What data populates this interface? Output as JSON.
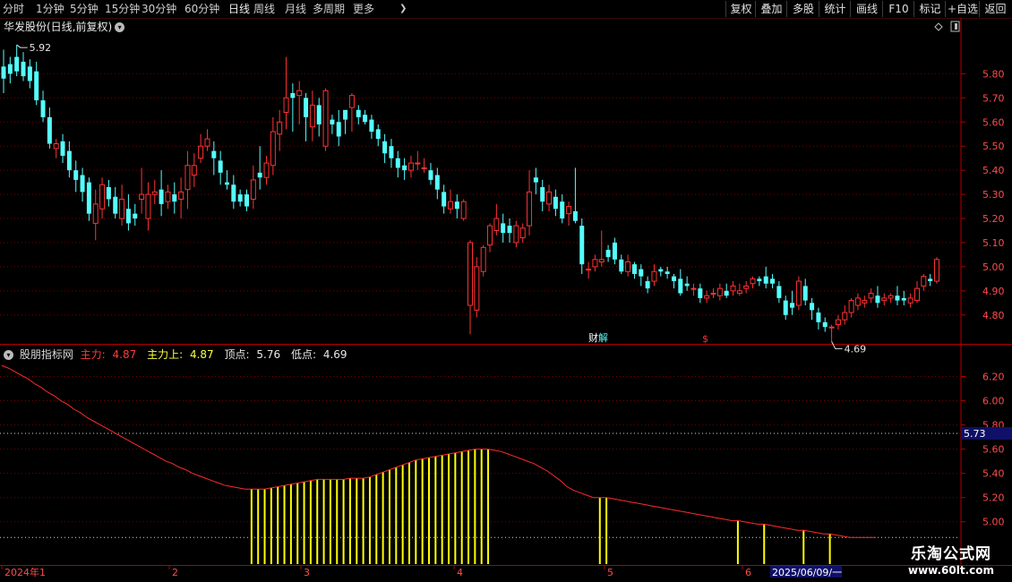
{
  "toolbar": {
    "periods": [
      "分时",
      "1分钟",
      "5分钟",
      "15分钟",
      "30分钟",
      "60分钟",
      "日线",
      "周线",
      "月线",
      "多周期",
      "更多"
    ],
    "more_arrow": "❯",
    "right_buttons": [
      "复权",
      "叠加",
      "多股",
      "统计",
      "画线",
      "F10",
      "标记",
      "+自选",
      "返回"
    ]
  },
  "main_title": {
    "text": "华发股份(日线,前复权)",
    "circle": "▾"
  },
  "indicator_title": {
    "name": "股朋指标网",
    "l1": "主力:",
    "v1": "4.87",
    "l2": "主力上:",
    "v2": "4.87",
    "l3": "顶点:",
    "v3": "5.76",
    "l4": "低点:",
    "v4": "4.69"
  },
  "watermark": {
    "name": "乐淘公式网",
    "url": "www.60lt.com"
  },
  "chart_data": [
    {
      "type": "candlestick",
      "title": "华发股份(日线,前复权)",
      "y_ticks": [
        5.8,
        5.7,
        5.6,
        5.5,
        5.4,
        5.3,
        5.2,
        5.1,
        5.0,
        4.9,
        4.8
      ],
      "ylim": [
        4.71,
        5.95
      ],
      "max_label": "5.92",
      "min_label": "4.69",
      "event_labels": [
        "财",
        "解",
        "$"
      ],
      "colors": {
        "up": "#ff3232",
        "down": "#54ffff",
        "grid": "#7a0000",
        "axis_text": "#ff4c4c"
      },
      "bars": [
        [
          5.83,
          5.78,
          5.9,
          5.72
        ],
        [
          5.84,
          5.8,
          5.87,
          5.76
        ],
        [
          5.87,
          5.81,
          5.92,
          5.79
        ],
        [
          5.85,
          5.79,
          5.89,
          5.77
        ],
        [
          5.83,
          5.77,
          5.86,
          5.74
        ],
        [
          5.81,
          5.69,
          5.85,
          5.67
        ],
        [
          5.69,
          5.62,
          5.73,
          5.6
        ],
        [
          5.62,
          5.51,
          5.66,
          5.49
        ],
        [
          5.49,
          5.51,
          5.53,
          5.45
        ],
        [
          5.52,
          5.46,
          5.55,
          5.43
        ],
        [
          5.48,
          5.4,
          5.52,
          5.37
        ],
        [
          5.4,
          5.36,
          5.44,
          5.31
        ],
        [
          5.38,
          5.31,
          5.41,
          5.27
        ],
        [
          5.35,
          5.22,
          5.37,
          5.19
        ],
        [
          5.18,
          5.26,
          5.32,
          5.11
        ],
        [
          5.24,
          5.34,
          5.37,
          5.2
        ],
        [
          5.33,
          5.28,
          5.36,
          5.25
        ],
        [
          5.29,
          5.22,
          5.33,
          5.2
        ],
        [
          5.2,
          5.28,
          5.34,
          5.17
        ],
        [
          5.24,
          5.18,
          5.3,
          5.15
        ],
        [
          5.22,
          5.2,
          5.26,
          5.17
        ],
        [
          5.28,
          5.3,
          5.41,
          5.22
        ],
        [
          5.2,
          5.3,
          5.35,
          5.15
        ],
        [
          5.3,
          5.31,
          5.36,
          5.26
        ],
        [
          5.32,
          5.26,
          5.4,
          5.21
        ],
        [
          5.27,
          5.31,
          5.34,
          5.24
        ],
        [
          5.3,
          5.27,
          5.35,
          5.22
        ],
        [
          5.28,
          5.31,
          5.37,
          5.2
        ],
        [
          5.32,
          5.42,
          5.48,
          5.24
        ],
        [
          5.38,
          5.42,
          5.47,
          5.33
        ],
        [
          5.45,
          5.5,
          5.55,
          5.43
        ],
        [
          5.5,
          5.53,
          5.57,
          5.48
        ],
        [
          5.48,
          5.45,
          5.52,
          5.38
        ],
        [
          5.44,
          5.39,
          5.48,
          5.34
        ],
        [
          5.35,
          5.34,
          5.4,
          5.32
        ],
        [
          5.34,
          5.27,
          5.38,
          5.24
        ],
        [
          5.3,
          5.27,
          5.32,
          5.25
        ],
        [
          5.3,
          5.25,
          5.32,
          5.23
        ],
        [
          5.28,
          5.36,
          5.42,
          5.24
        ],
        [
          5.39,
          5.37,
          5.5,
          5.32
        ],
        [
          5.37,
          5.43,
          5.46,
          5.34
        ],
        [
          5.42,
          5.56,
          5.62,
          5.38
        ],
        [
          5.55,
          5.6,
          5.65,
          5.48
        ],
        [
          5.64,
          5.7,
          5.87,
          5.57
        ],
        [
          5.72,
          5.7,
          5.76,
          5.56
        ],
        [
          5.71,
          5.73,
          5.77,
          5.59
        ],
        [
          5.7,
          5.62,
          5.72,
          5.52
        ],
        [
          5.58,
          5.67,
          5.73,
          5.52
        ],
        [
          5.67,
          5.59,
          5.7,
          5.54
        ],
        [
          5.5,
          5.73,
          5.74,
          5.48
        ],
        [
          5.61,
          5.59,
          5.63,
          5.55
        ],
        [
          5.6,
          5.54,
          5.65,
          5.5
        ],
        [
          5.65,
          5.61,
          5.64,
          5.55
        ],
        [
          5.66,
          5.71,
          5.72,
          5.56
        ],
        [
          5.65,
          5.62,
          5.67,
          5.59
        ],
        [
          5.63,
          5.6,
          5.65,
          5.59
        ],
        [
          5.61,
          5.56,
          5.63,
          5.53
        ],
        [
          5.57,
          5.53,
          5.59,
          5.5
        ],
        [
          5.52,
          5.47,
          5.55,
          5.43
        ],
        [
          5.5,
          5.45,
          5.53,
          5.41
        ],
        [
          5.45,
          5.41,
          5.48,
          5.37
        ],
        [
          5.42,
          5.4,
          5.45,
          5.36
        ],
        [
          5.4,
          5.43,
          5.46,
          5.37
        ],
        [
          5.43,
          5.43,
          5.48,
          5.4
        ],
        [
          5.41,
          5.41,
          5.45,
          5.39
        ],
        [
          5.4,
          5.36,
          5.43,
          5.34
        ],
        [
          5.38,
          5.32,
          5.41,
          5.28
        ],
        [
          5.31,
          5.25,
          5.34,
          5.22
        ],
        [
          5.24,
          5.27,
          5.32,
          5.22
        ],
        [
          5.27,
          5.24,
          5.3,
          5.2
        ],
        [
          5.2,
          5.27,
          5.28,
          5.19
        ],
        [
          4.84,
          5.1,
          5.11,
          4.72
        ],
        [
          4.82,
          5.0,
          5.04,
          4.79
        ],
        [
          4.98,
          5.08,
          5.09,
          4.96
        ],
        [
          5.09,
          5.17,
          5.18,
          5.06
        ],
        [
          5.15,
          5.2,
          5.26,
          5.13
        ],
        [
          5.18,
          5.14,
          5.22,
          5.1
        ],
        [
          5.17,
          5.14,
          5.2,
          5.1
        ],
        [
          5.1,
          5.17,
          5.19,
          5.08
        ],
        [
          5.12,
          5.16,
          5.18,
          5.1
        ],
        [
          5.17,
          5.31,
          5.4,
          5.13
        ],
        [
          5.37,
          5.35,
          5.41,
          5.3
        ],
        [
          5.33,
          5.27,
          5.36,
          5.23
        ],
        [
          5.26,
          5.31,
          5.34,
          5.23
        ],
        [
          5.29,
          5.24,
          5.32,
          5.21
        ],
        [
          5.27,
          5.2,
          5.3,
          5.18
        ],
        [
          5.22,
          5.25,
          5.27,
          5.17
        ],
        [
          5.23,
          5.19,
          5.41,
          5.18
        ],
        [
          5.17,
          5.01,
          5.2,
          4.97
        ],
        [
          4.99,
          4.99,
          5.02,
          4.95
        ],
        [
          5.0,
          5.03,
          5.05,
          4.98
        ],
        [
          5.02,
          5.03,
          5.15,
          5.0
        ],
        [
          5.07,
          5.04,
          5.09,
          5.02
        ],
        [
          5.1,
          5.03,
          5.12,
          5.01
        ],
        [
          5.03,
          4.98,
          5.05,
          4.97
        ],
        [
          4.98,
          5.02,
          5.05,
          4.96
        ],
        [
          5.01,
          4.97,
          5.02,
          4.95
        ],
        [
          4.99,
          4.96,
          5.01,
          4.92
        ],
        [
          4.94,
          4.91,
          4.96,
          4.89
        ],
        [
          4.94,
          4.98,
          5.01,
          4.92
        ],
        [
          4.99,
          4.98,
          5.0,
          4.96
        ],
        [
          4.98,
          4.97,
          5.0,
          4.95
        ],
        [
          4.96,
          4.94,
          4.97,
          4.91
        ],
        [
          4.95,
          4.89,
          4.99,
          4.88
        ],
        [
          4.93,
          4.92,
          4.96,
          4.9
        ],
        [
          4.91,
          4.91,
          4.93,
          4.88
        ],
        [
          4.91,
          4.87,
          4.93,
          4.85
        ],
        [
          4.87,
          4.88,
          4.9,
          4.85
        ],
        [
          4.89,
          4.89,
          4.91,
          4.87
        ],
        [
          4.88,
          4.91,
          4.93,
          4.86
        ],
        [
          4.9,
          4.88,
          4.93,
          4.87
        ],
        [
          4.9,
          4.92,
          4.94,
          4.88
        ],
        [
          4.89,
          4.9,
          4.93,
          4.88
        ],
        [
          4.91,
          4.92,
          4.94,
          4.89
        ],
        [
          4.93,
          4.95,
          4.96,
          4.91
        ],
        [
          4.95,
          4.94,
          4.96,
          4.92
        ],
        [
          4.96,
          4.93,
          5.0,
          4.91
        ],
        [
          4.95,
          4.93,
          4.97,
          4.91
        ],
        [
          4.92,
          4.87,
          4.94,
          4.85
        ],
        [
          4.86,
          4.8,
          4.88,
          4.78
        ],
        [
          4.85,
          4.83,
          4.9,
          4.8
        ],
        [
          4.84,
          4.94,
          4.96,
          4.82
        ],
        [
          4.92,
          4.86,
          4.95,
          4.84
        ],
        [
          4.85,
          4.82,
          4.87,
          4.78
        ],
        [
          4.81,
          4.77,
          4.83,
          4.74
        ],
        [
          4.77,
          4.75,
          4.79,
          4.73
        ],
        [
          4.75,
          4.75,
          4.76,
          4.69
        ],
        [
          4.76,
          4.78,
          4.8,
          4.74
        ],
        [
          4.78,
          4.81,
          4.84,
          4.76
        ],
        [
          4.81,
          4.86,
          4.87,
          4.79
        ],
        [
          4.84,
          4.87,
          4.89,
          4.82
        ],
        [
          4.85,
          4.86,
          4.88,
          4.83
        ],
        [
          4.87,
          4.89,
          4.91,
          4.85
        ],
        [
          4.88,
          4.85,
          4.92,
          4.83
        ],
        [
          4.86,
          4.87,
          4.89,
          4.84
        ],
        [
          4.87,
          4.88,
          4.89,
          4.85
        ],
        [
          4.88,
          4.86,
          4.92,
          4.84
        ],
        [
          4.87,
          4.86,
          4.9,
          4.84
        ],
        [
          4.85,
          4.87,
          4.89,
          4.83
        ],
        [
          4.86,
          4.91,
          4.94,
          4.85
        ],
        [
          4.92,
          4.96,
          4.97,
          4.9
        ],
        [
          4.95,
          4.94,
          4.97,
          4.92
        ],
        [
          4.94,
          5.03,
          5.04,
          4.93
        ]
      ]
    },
    {
      "type": "line",
      "title": "股朋指标网",
      "y_ticks": [
        6.2,
        6.0,
        5.8,
        5.6,
        5.4,
        5.2,
        5.0
      ],
      "ylim": [
        4.85,
        6.3
      ],
      "dotted_levels": [
        5.73,
        4.87
      ],
      "highlight_value": "5.73",
      "series": [
        {
          "name": "主力",
          "color": "#ff2a2a",
          "values": [
            6.29,
            6.27,
            6.24,
            6.21,
            6.18,
            6.14,
            6.11,
            6.07,
            6.04,
            6.0,
            5.97,
            5.93,
            5.9,
            5.86,
            5.83,
            5.8,
            5.77,
            5.74,
            5.71,
            5.68,
            5.65,
            5.62,
            5.59,
            5.56,
            5.53,
            5.5,
            5.48,
            5.45,
            5.43,
            5.4,
            5.38,
            5.36,
            5.34,
            5.32,
            5.3,
            5.29,
            5.28,
            5.27,
            5.27,
            5.27,
            5.27,
            5.28,
            5.29,
            5.3,
            5.31,
            5.32,
            5.33,
            5.34,
            5.35,
            5.35,
            5.35,
            5.35,
            5.35,
            5.36,
            5.36,
            5.36,
            5.37,
            5.39,
            5.41,
            5.43,
            5.45,
            5.47,
            5.49,
            5.51,
            5.52,
            5.53,
            5.54,
            5.55,
            5.56,
            5.57,
            5.58,
            5.59,
            5.6,
            5.6,
            5.6,
            5.59,
            5.58,
            5.56,
            5.54,
            5.52,
            5.5,
            5.48,
            5.45,
            5.42,
            5.38,
            5.34,
            5.29,
            5.26,
            5.24,
            5.22,
            5.2,
            5.2,
            5.2,
            5.19,
            5.18,
            5.17,
            5.16,
            5.15,
            5.14,
            5.13,
            5.12,
            5.11,
            5.1,
            5.09,
            5.08,
            5.07,
            5.06,
            5.05,
            5.04,
            5.03,
            5.02,
            5.01,
            5.01,
            5.0,
            4.99,
            4.98,
            4.98,
            4.97,
            4.96,
            4.95,
            4.94,
            4.93,
            4.93,
            4.92,
            4.91,
            4.9,
            4.9,
            4.89,
            4.88,
            4.87,
            4.87,
            4.87,
            4.87,
            4.87
          ]
        },
        {
          "name": "主力上",
          "color": "#ffff00",
          "style": "histogram"
        }
      ]
    }
  ],
  "x_axis": {
    "labels": [
      "2024年1",
      "2",
      "3",
      "4",
      "5",
      "6"
    ],
    "cursor_date": "2025/06/09/一"
  }
}
